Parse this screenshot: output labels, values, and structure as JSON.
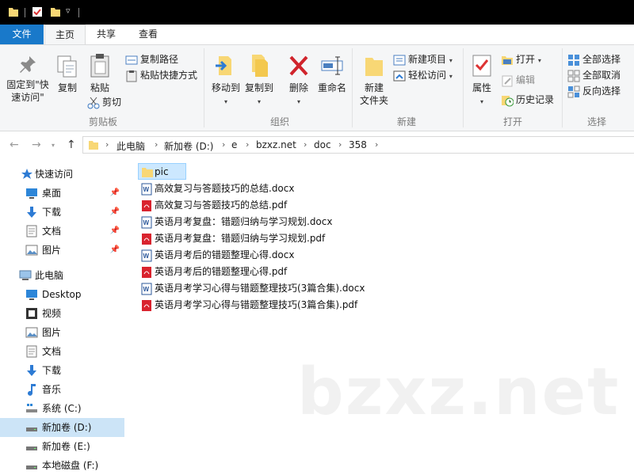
{
  "ribbon_tabs": {
    "file": "文件",
    "home": "主页",
    "share": "共享",
    "view": "查看"
  },
  "clipboard": {
    "pin_quick_access": "固定到\"快速访问\"",
    "copy": "复制",
    "paste": "粘贴",
    "copy_path": "复制路径",
    "paste_shortcut": "粘贴快捷方式",
    "cut": "剪切",
    "group_label": "剪贴板"
  },
  "organize": {
    "move_to": "移动到",
    "copy_to": "复制到",
    "delete": "删除",
    "rename": "重命名",
    "group_label": "组织"
  },
  "new_group": {
    "new_folder": "新建\n文件夹",
    "new_item": "新建项目",
    "easy_access": "轻松访问",
    "group_label": "新建"
  },
  "open_group": {
    "properties": "属性",
    "open": "打开",
    "edit": "编辑",
    "history": "历史记录",
    "group_label": "打开"
  },
  "select_group": {
    "select_all": "全部选择",
    "select_none": "全部取消",
    "invert": "反向选择",
    "group_label": "选择"
  },
  "breadcrumb": [
    "此电脑",
    "新加卷 (D:)",
    "e",
    "bzxz.net",
    "doc",
    "358"
  ],
  "sidebar": {
    "quick_access": "快速访问",
    "quick_items": [
      "桌面",
      "下载",
      "文档",
      "图片"
    ],
    "this_pc": "此电脑",
    "pc_items": [
      "Desktop",
      "视频",
      "图片",
      "文档",
      "下载",
      "音乐",
      "系统 (C:)",
      "新加卷 (D:)",
      "新加卷 (E:)",
      "本地磁盘 (F:)"
    ]
  },
  "files": [
    {
      "name": "pic",
      "type": "folder"
    },
    {
      "name": "高效复习与答题技巧的总结.docx",
      "type": "docx"
    },
    {
      "name": "高效复习与答题技巧的总结.pdf",
      "type": "pdf"
    },
    {
      "name": "英语月考复盘：错题归纳与学习规划.docx",
      "type": "docx"
    },
    {
      "name": "英语月考复盘：错题归纳与学习规划.pdf",
      "type": "pdf"
    },
    {
      "name": "英语月考后的错题整理心得.docx",
      "type": "docx"
    },
    {
      "name": "英语月考后的错题整理心得.pdf",
      "type": "pdf"
    },
    {
      "name": "英语月考学习心得与错题整理技巧(3篇合集).docx",
      "type": "docx"
    },
    {
      "name": "英语月考学习心得与错题整理技巧(3篇合集).pdf",
      "type": "pdf"
    }
  ],
  "watermark": "bzxz.net",
  "colors": {
    "accent": "#1979ca",
    "folder": "#f8d775",
    "pdf": "#d9232e",
    "word": "#2b579a",
    "selected": "#cce8ff"
  }
}
